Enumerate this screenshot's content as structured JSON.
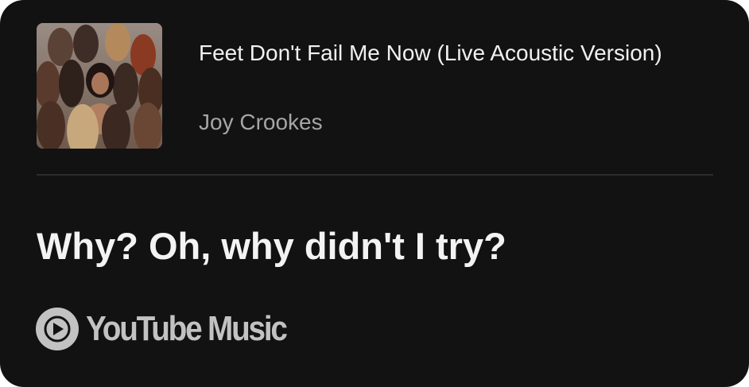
{
  "track": {
    "title": "Feet Don't Fail Me Now (Live Acoustic Version)",
    "artist": "Joy Crookes"
  },
  "lyric": {
    "line": "Why? Oh, why didn't I try?"
  },
  "brand": {
    "name": "YouTube Music",
    "icon": "youtube-music-play-icon"
  },
  "colors": {
    "card_background": "#121212",
    "title": "#f1f1f1",
    "artist": "#a6a6a6",
    "lyric": "#f3f3f3",
    "brand": "#c2c2c2"
  }
}
